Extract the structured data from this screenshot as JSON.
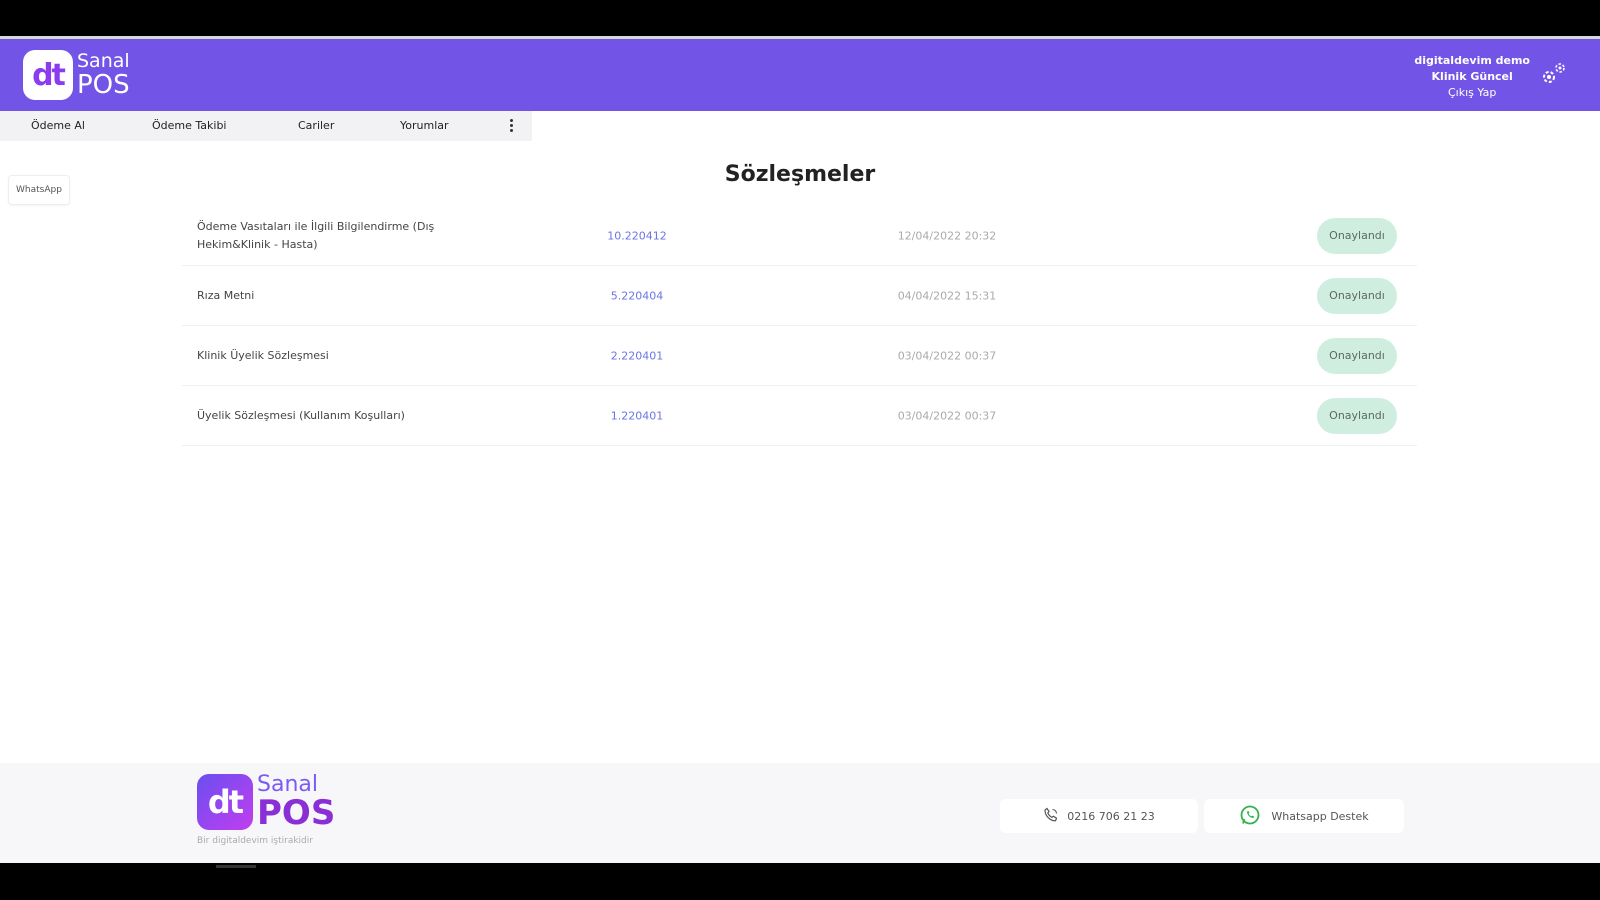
{
  "header": {
    "logo": {
      "mark": "dt",
      "line1": "Sanal",
      "line2": "POS"
    },
    "user": {
      "account": "digitaldevim demo",
      "clinic": "Klinik Güncel",
      "logout": "Çıkış Yap"
    },
    "settings_icon": "gear-icon"
  },
  "nav": {
    "items": [
      {
        "label": "Ödeme Al"
      },
      {
        "label": "Ödeme Takibi"
      },
      {
        "label": "Cariler"
      },
      {
        "label": "Yorumlar"
      }
    ],
    "more_icon": "more-vertical-icon"
  },
  "sidebar": {
    "whatsapp_label": "WhatsApp"
  },
  "main": {
    "title": "Sözleşmeler",
    "contracts": [
      {
        "title": "Ödeme Vasıtaları ile İlgili Bilgilendirme (Dış Hekim&Klinik - Hasta)",
        "number": "10.220412",
        "date": "12/04/2022 20:32",
        "status": "Onaylandı"
      },
      {
        "title": "Rıza Metni",
        "number": "5.220404",
        "date": "04/04/2022 15:31",
        "status": "Onaylandı"
      },
      {
        "title": "Klinik Üyelik Sözleşmesi",
        "number": "2.220401",
        "date": "03/04/2022 00:37",
        "status": "Onaylandı"
      },
      {
        "title": "Üyelik Sözleşmesi (Kullanım Koşulları)",
        "number": "1.220401",
        "date": "03/04/2022 00:37",
        "status": "Onaylandı"
      }
    ]
  },
  "footer": {
    "logo": {
      "mark": "dt",
      "line1": "Sanal",
      "line2": "POS"
    },
    "tagline": "Bir digitaldevim iştirakidir",
    "phone": "0216 706 21 23",
    "whatsapp": "Whatsapp Destek",
    "phone_icon": "phone-icon",
    "whatsapp_icon": "whatsapp-icon"
  },
  "colors": {
    "header_bg": "#7255e6",
    "status_bg": "#cfeee0",
    "link": "#6b74e8"
  }
}
